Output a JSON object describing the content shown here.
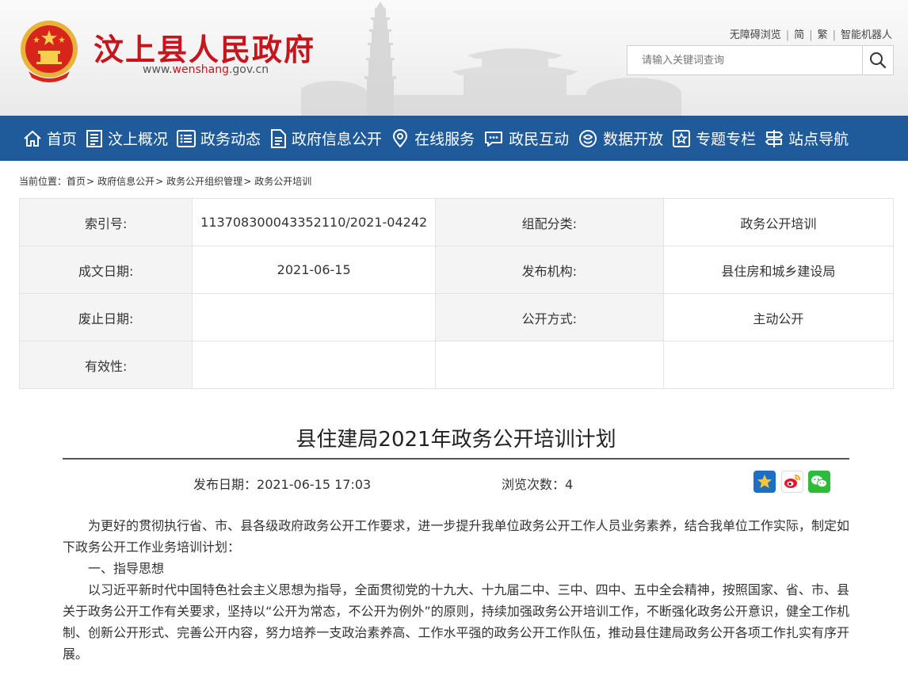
{
  "header": {
    "site_title": "汶上县人民政府",
    "domain_prefix": "www.",
    "domain_highlight": "wenshang",
    "domain_suffix": ".gov.cn",
    "top_links": [
      "无障碍浏览",
      "简",
      "繁",
      "智能机器人"
    ],
    "search_placeholder": "请输入关键词查询"
  },
  "nav": {
    "items": [
      {
        "label": "首页",
        "icon": "home-icon"
      },
      {
        "label": "汶上概况",
        "icon": "document-icon"
      },
      {
        "label": "政务动态",
        "icon": "list-icon"
      },
      {
        "label": "政府信息公开",
        "icon": "file-icon"
      },
      {
        "label": "在线服务",
        "icon": "location-icon"
      },
      {
        "label": "政民互动",
        "icon": "chat-icon"
      },
      {
        "label": "数据开放",
        "icon": "data-icon"
      },
      {
        "label": "专题专栏",
        "icon": "star-icon"
      },
      {
        "label": "站点导航",
        "icon": "signpost-icon"
      }
    ]
  },
  "breadcrumb": {
    "label": "当前位置：",
    "items": [
      "首页",
      "政府信息公开",
      "政务公开组织管理",
      "政务公开培训"
    ]
  },
  "info_table": {
    "rows": [
      {
        "k1": "索引号:",
        "v1": "113708300043352110/2021-04242",
        "k2": "组配分类:",
        "v2": "政务公开培训"
      },
      {
        "k1": "成文日期:",
        "v1": "2021-06-15",
        "k2": "发布机构:",
        "v2": "县住房和城乡建设局"
      },
      {
        "k1": "废止日期:",
        "v1": "",
        "k2": "公开方式:",
        "v2": "主动公开"
      },
      {
        "k1": "有效性:",
        "v1": "",
        "k2": "",
        "v2": ""
      }
    ]
  },
  "article": {
    "title": "县住建局2021年政务公开培训计划",
    "publish_label": "发布日期：",
    "publish_date": "2021-06-15 17:03",
    "views_label": "浏览次数：",
    "views": "4",
    "paragraphs": [
      "为更好的贯彻执行省、市、县各级政府政务公开工作要求，进一步提升我单位政务公开工作人员业务素养，结合我单位工作实际，制定如下政务公开工作业务培训计划：",
      "一、指导思想",
      "以习近平新时代中国特色社会主义思想为指导，全面贯彻党的十九大、十九届二中、三中、四中、五中全会精神，按照国家、省、市、县关于政务公开工作有关要求，坚持以“公开为常态，不公开为例外”的原则，持续加强政务公开培训工作，不断强化政务公开意识，健全工作机制、创新公开形式、完善公开内容，努力培养一支政治素养高、工作水平强的政务公开工作队伍，推动县住建局政务公开各项工作扎实有序开展。"
    ]
  },
  "colors": {
    "brand_red": "#c4161c",
    "nav_blue": "#1f5a9b"
  }
}
